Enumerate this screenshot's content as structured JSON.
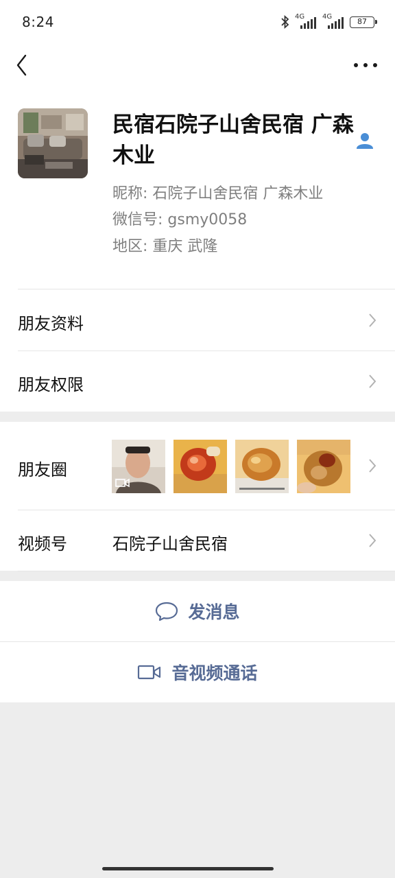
{
  "status_bar": {
    "time": "8:24",
    "network1": "4G",
    "network2": "4G",
    "battery": "87"
  },
  "profile": {
    "name": "民宿石院子山舍民宿  广森木业",
    "nickname_label": "昵称:",
    "nickname": "石院子山舍民宿 广森木业",
    "wechat_id_label": "微信号:",
    "wechat_id": "gsmy0058",
    "region_label": "地区:",
    "region": "重庆  武隆"
  },
  "rows": {
    "friend_info": "朋友资料",
    "friend_permissions": "朋友权限",
    "moments": "朋友圈",
    "channels": "视频号",
    "channels_value": "石院子山舍民宿"
  },
  "actions": {
    "send_message": "发消息",
    "video_call": "音视频通话"
  },
  "colors": {
    "link_blue": "#576b95",
    "contact_icon_blue": "#4a8ed6",
    "background": "#ededed"
  }
}
